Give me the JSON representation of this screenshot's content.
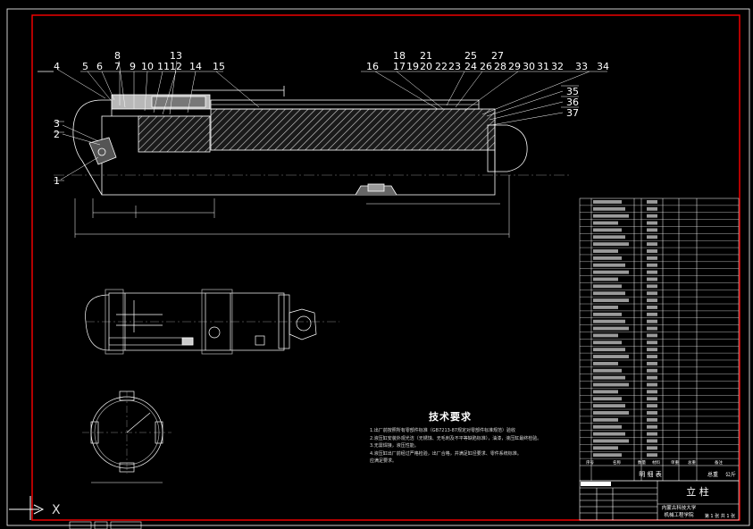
{
  "balloons": {
    "top_left": [
      "4",
      "5",
      "6",
      "7",
      "8",
      "9",
      "10",
      "11",
      "12",
      "13",
      "14",
      "15"
    ],
    "top_right": [
      "16",
      "17",
      "18",
      "19",
      "20",
      "21",
      "22",
      "23",
      "24",
      "25",
      "26",
      "27",
      "28",
      "29",
      "30",
      "31",
      "32",
      "33",
      "34"
    ],
    "right_stack": [
      "35",
      "36",
      "37"
    ],
    "left_side": [
      "3",
      "2",
      "1"
    ]
  },
  "tech_requirements": {
    "title": "技术要求",
    "lines": [
      "1.出厂前按照所有零部件标准（GB7213-87规定对零部件标准规范）验收",
      "2.液压缸安装外观光洁（无锈蚀、无毛刺及不平等缺陷标准），油漆，液压缸最终检验。",
      "3.无需焊接，液压性能。",
      "4.液压缸出厂前经过严格检验，出厂合格，并满足缸径要求、零件系统标准。",
      "应满足要求。"
    ]
  },
  "parts_table": {
    "header_cols": [
      "序号",
      "名称",
      "数量",
      "材料",
      "单重",
      "总重",
      "备注"
    ],
    "footer_title": "明  细  表",
    "weight_label": "总重",
    "unit_label": "公斤"
  },
  "title_block": {
    "drawing_name": "立 柱",
    "school": "内蒙古科技大学",
    "college": "机械工程学院",
    "sheet": "第 1 张 共 1 张"
  },
  "ui": {
    "axis_x_label": "X"
  },
  "colors": {
    "frame": "#ff0000",
    "lines": "#ffffff",
    "hatch": "#cfcfcf",
    "background": "#000000"
  }
}
